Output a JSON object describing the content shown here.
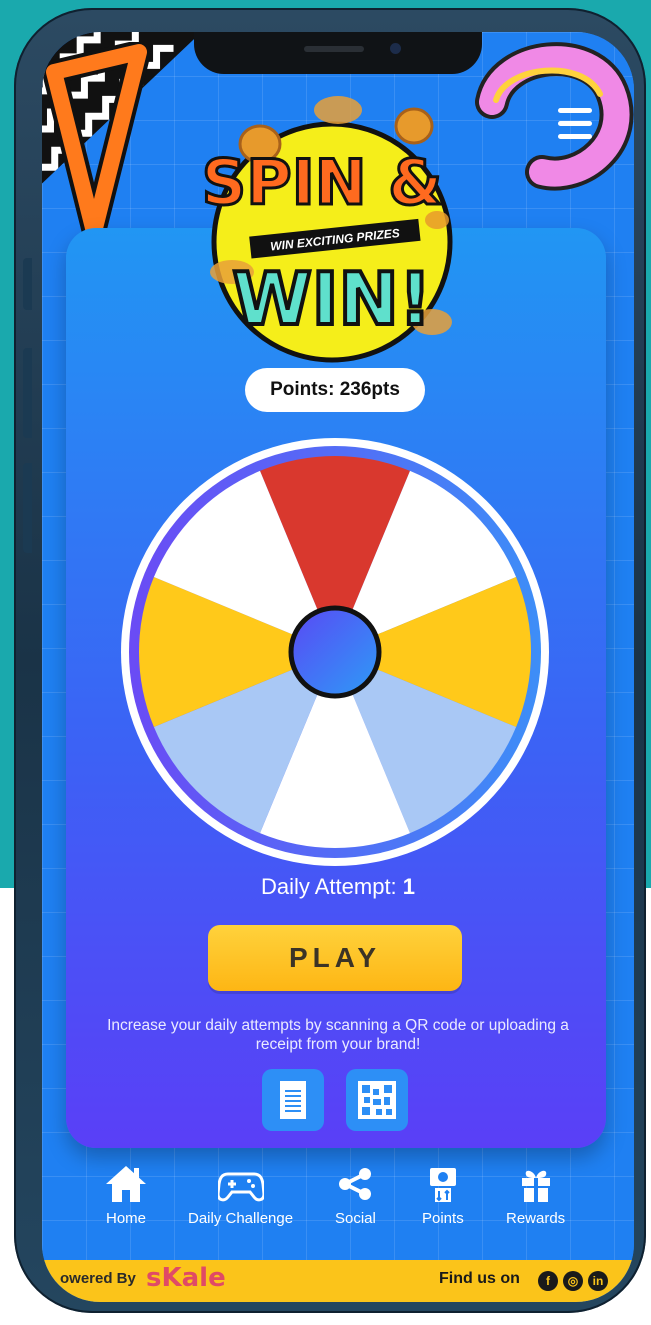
{
  "logo": {
    "line1": "SPIN &",
    "banner": "WIN EXCITING PRIZES",
    "line2": "WIN!"
  },
  "points": {
    "label": "Points: 236pts"
  },
  "wheel": {
    "segments": 8,
    "colors": [
      "#d9382e",
      "#ffffff",
      "#ffc91a",
      "#a9c8f5",
      "#ffffff",
      "#a9c8f5",
      "#ffc91a",
      "#ffffff"
    ]
  },
  "attempt": {
    "label": "Daily Attempt: ",
    "count": "1"
  },
  "play": {
    "label": "PLAY"
  },
  "hint": {
    "text": "Increase your daily attempts by scanning a QR code or uploading a receipt from your brand!"
  },
  "actions": {
    "receipt_icon": "receipt-icon",
    "qr_icon": "qr-code-icon"
  },
  "nav": {
    "items": [
      {
        "label": "Home",
        "icon": "home-icon"
      },
      {
        "label": "Daily Challenge",
        "icon": "gamepad-icon"
      },
      {
        "label": "Social",
        "icon": "share-icon"
      },
      {
        "label": "Points",
        "icon": "points-icon"
      },
      {
        "label": "Rewards",
        "icon": "gift-icon"
      }
    ]
  },
  "footer": {
    "powered": "owered By",
    "brand": "sKale",
    "find": "Find us on",
    "social": [
      "facebook-icon",
      "instagram-icon",
      "linkedin-icon"
    ]
  },
  "colors": {
    "teal": "#1aa9ad",
    "screen_blue": "#1f80f2",
    "card_top": "#2196f3",
    "card_bottom": "#5a3ff7",
    "accent_yellow": "#fbc41a",
    "wheel_red": "#d9382e"
  }
}
